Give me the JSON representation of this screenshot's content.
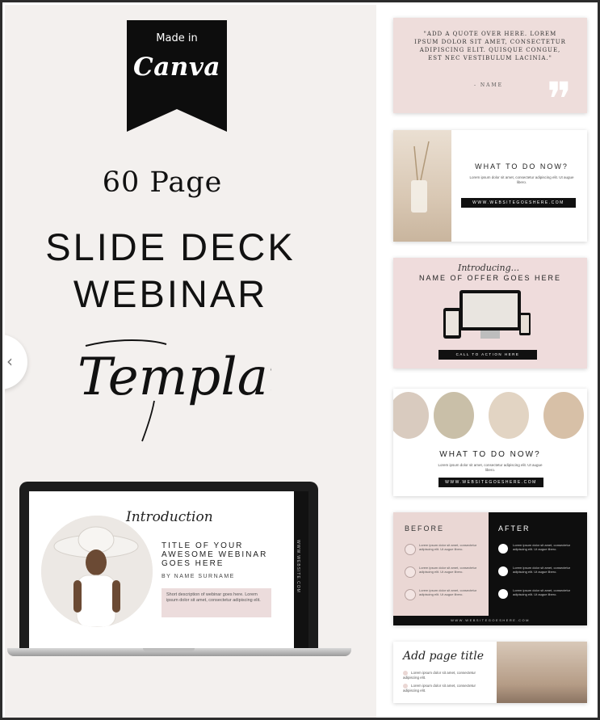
{
  "badge": {
    "small": "Made in",
    "big": "Canva"
  },
  "hero": {
    "page_count": "60 Page",
    "line1": "SLIDE DECK",
    "line2": "WEBINAR",
    "script": "Template"
  },
  "nav": {
    "prev_arrow": "‹"
  },
  "laptop": {
    "intro": "Introduction",
    "title": "TITLE OF YOUR AWESOME WEBINAR GOES HERE",
    "name": "BY NAME SURNAME",
    "desc": "Short description of webinar goes here. Lorem ipsum dolor sit amet, consectetur adipiscing elit.",
    "side_url": "WWW.WEBSITE.COM"
  },
  "previews": {
    "quote": {
      "text": "\"ADD A QUOTE OVER HERE. LOREM IPSUM DOLOR SIT AMET, CONSECTETUR ADIPISCING ELIT. QUISQUE CONGUE, EST NEC VESTIBULUM LACINIA.\"",
      "name": "- NAME"
    },
    "slide2": {
      "title": "WHAT TO DO NOW?",
      "body": "Lorem ipsum dolor sit amet, consectetur adipiscing elit. Ut augue libero.",
      "url": "WWW.WEBSITEGOESHERE.COM"
    },
    "slide3": {
      "script": "Introducing...",
      "title": "NAME OF OFFER GOES HERE",
      "url": "CALL TO ACTION HERE"
    },
    "slide4": {
      "title": "WHAT TO DO NOW?",
      "body": "Lorem ipsum dolor sit amet, consectetur adipiscing elit. Ut augue libero.",
      "url": "WWW.WEBSITEGOESHERE.COM"
    },
    "slide5": {
      "before": "BEFORE",
      "after": "AFTER",
      "item_text": "Lorem ipsum dolor sit amet, consectetur adipiscing elit. Ut augue libero.",
      "foot": "WWW.WEBSITEGOESHERE.COM"
    },
    "slide6": {
      "title": "Add page title",
      "item_text": "Lorem ipsum dolor sit amet, consectetur adipiscing elit."
    }
  },
  "colors": {
    "blush": "#ead7d4",
    "black": "#111111",
    "cream": "#f3f0ee"
  }
}
